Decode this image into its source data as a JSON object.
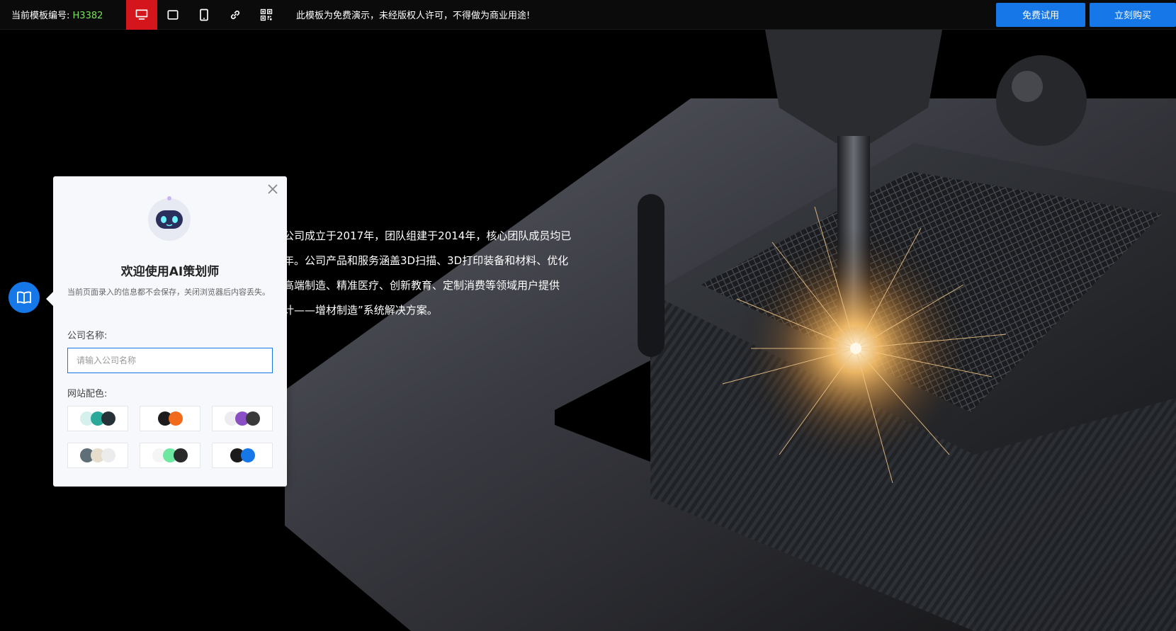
{
  "topbar": {
    "template_label": "当前模板编号:",
    "template_code": "H3382",
    "notice": "此模板为免费演示，未经版权人许可，不得做为商业用途!",
    "free_trial": "免费试用",
    "buy_now": "立刻购买",
    "devices": [
      "desktop-icon",
      "tablet-landscape-icon",
      "tablet-portrait-icon",
      "link-icon",
      "qrcode-icon"
    ],
    "active_device": "desktop-icon"
  },
  "hero": {
    "text_lines": [
      "公司成立于2017年，团队组建于2014年，核心团队成员均已",
      "年。公司产品和服务涵盖3D扫描、3D打印装备和材料、优化",
      "高端制造、精准医疗、创新教育、定制消费等领域用户提供",
      "计——增材制造”系统解决方案。"
    ]
  },
  "ai_panel": {
    "trigger_icon": "book-icon",
    "title": "欢迎使用AI策划师",
    "description": "当前页面录入的信息都不会保存，关闭浏览器后内容丢失。",
    "company_label": "公司名称:",
    "company_placeholder": "请输入公司名称",
    "company_value": "",
    "color_label": "网站配色:",
    "palettes": [
      [
        "#d6f0ee",
        "#2aa89a",
        "#263238"
      ],
      [
        "#1c1c1c",
        "#f26a1b"
      ],
      [
        "#ececf1",
        "#8a4fc4",
        "#3a3a3a"
      ],
      [
        "#5f6f78",
        "#e5dccc",
        "#ececec"
      ],
      [
        "#f5f5f5",
        "#6ee7a0",
        "#2a2a2a"
      ],
      [
        "#1b1b1b",
        "#1677e8"
      ]
    ]
  },
  "colors": {
    "accent_red": "#d4151b",
    "accent_blue": "#1677e8",
    "code_green": "#7be05c"
  }
}
